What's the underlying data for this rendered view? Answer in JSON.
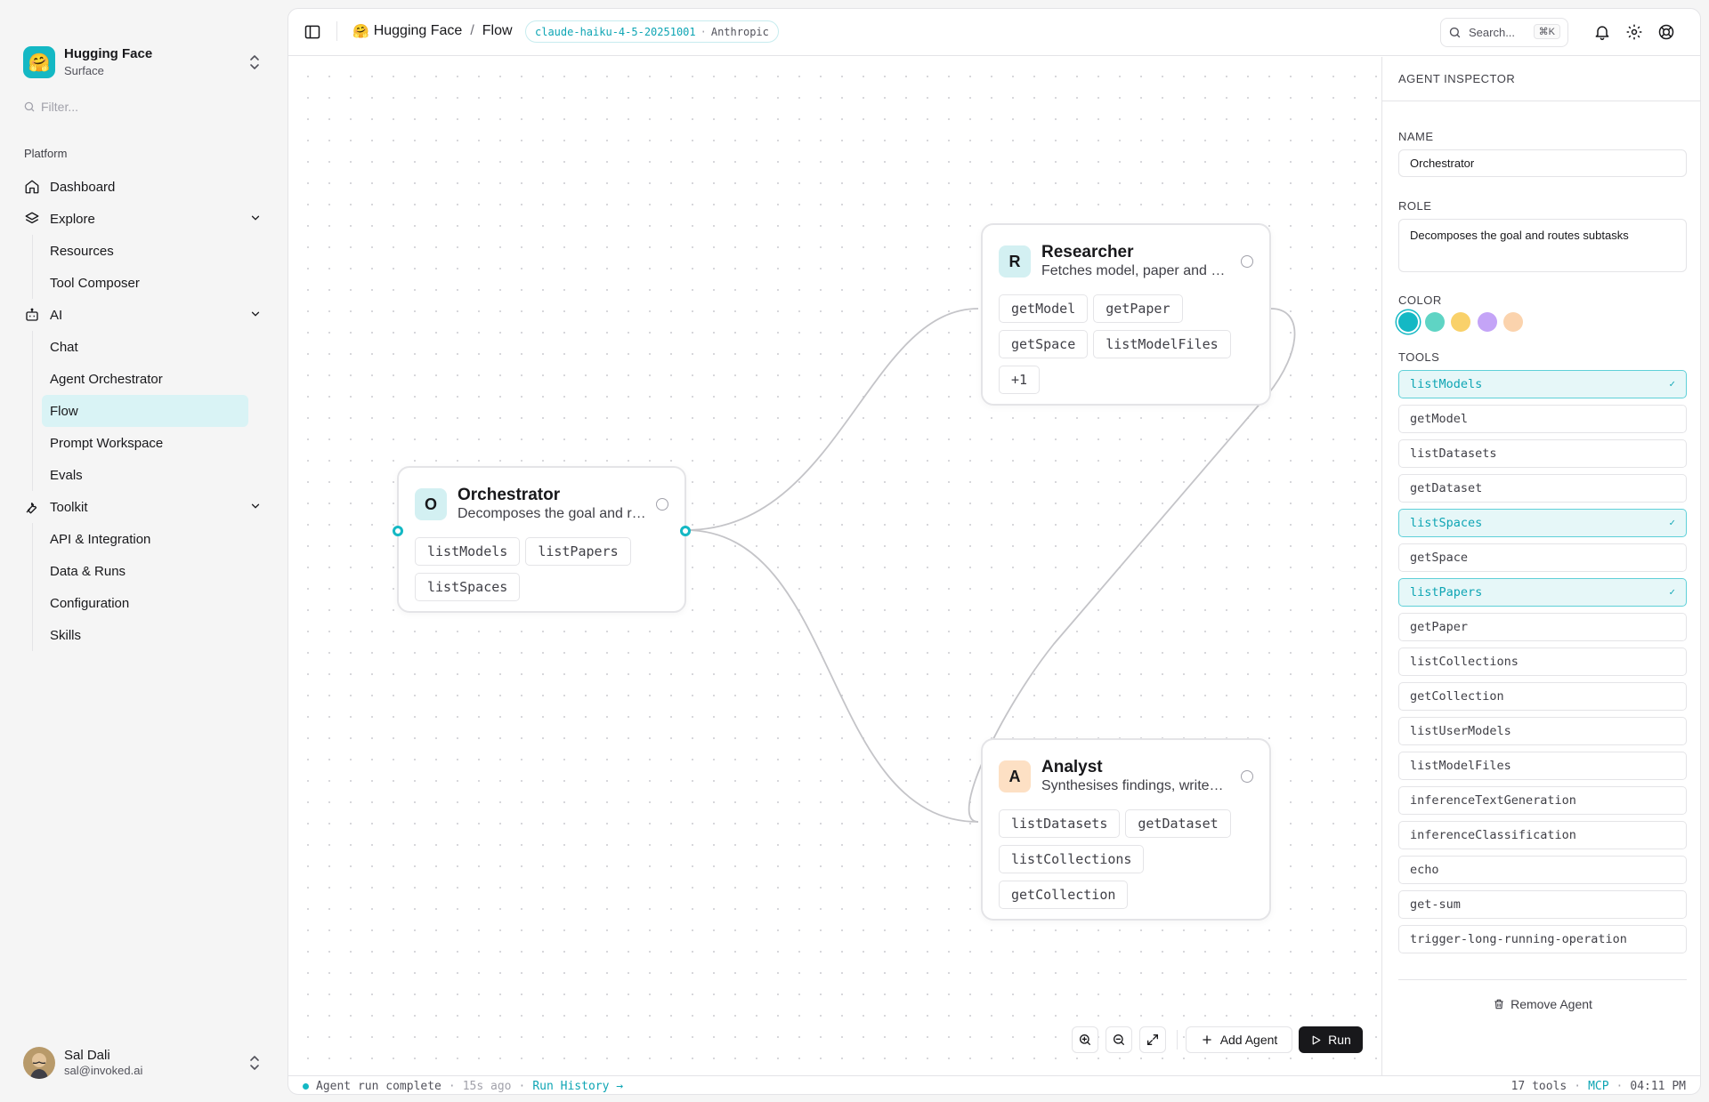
{
  "sidebar": {
    "brand": {
      "title": "Hugging Face",
      "subtitle": "Surface",
      "logo_emoji": "🤗"
    },
    "filter_placeholder": "Filter...",
    "section_label": "Platform",
    "nav": {
      "dashboard": "Dashboard",
      "explore": "Explore",
      "explore_items": [
        "Resources",
        "Tool Composer"
      ],
      "ai": "AI",
      "ai_items": [
        "Chat",
        "Agent Orchestrator",
        "Flow",
        "Prompt Workspace",
        "Evals"
      ],
      "ai_active": "Flow",
      "toolkit": "Toolkit",
      "toolkit_items": [
        "API & Integration",
        "Data & Runs",
        "Configuration",
        "Skills"
      ]
    },
    "user": {
      "name": "Sal Dali",
      "email": "sal@invoked.ai"
    }
  },
  "topbar": {
    "breadcrumb": {
      "org_emoji": "🤗",
      "org": "Hugging Face",
      "page": "Flow"
    },
    "model": {
      "id": "claude-haiku-4-5-20251001",
      "separator": "·",
      "provider": "Anthropic"
    },
    "search": {
      "placeholder": "Search...",
      "shortcut": "⌘K"
    }
  },
  "nodes": {
    "orchestrator": {
      "badge": "O",
      "badge_color": "#d3f0f2",
      "title": "Orchestrator",
      "desc": "Decomposes the goal and routes subtasks",
      "tools": [
        "listModels",
        "listPapers",
        "listSpaces"
      ]
    },
    "researcher": {
      "badge": "R",
      "badge_color": "#d3f0f2",
      "title": "Researcher",
      "desc": "Fetches model, paper and space details",
      "tools": [
        "getModel",
        "getPaper",
        "getSpace",
        "listModelFiles",
        "+1"
      ]
    },
    "analyst": {
      "badge": "A",
      "badge_color": "#fde0c4",
      "title": "Analyst",
      "desc": "Synthesises findings, writes the report",
      "tools": [
        "listDatasets",
        "getDataset",
        "listCollections",
        "getCollection"
      ]
    }
  },
  "canvas_controls": {
    "zoom_in": "zoom-in-icon",
    "zoom_out": "zoom-out-icon",
    "fit": "expand-icon",
    "add_agent": "Add Agent",
    "run": "Run"
  },
  "inspector": {
    "header": "AGENT INSPECTOR",
    "name_label": "NAME",
    "name_value": "Orchestrator",
    "role_label": "ROLE",
    "role_value": "Decomposes the goal and routes subtasks",
    "color_label": "COLOR",
    "colors": [
      "#14b8c4",
      "#5fd4c4",
      "#f9d16a",
      "#c4a4f7",
      "#fbd3ad"
    ],
    "selected_color": "#14b8c4",
    "tools_label": "TOOLS",
    "tools": [
      {
        "name": "listModels",
        "enabled": true
      },
      {
        "name": "getModel",
        "enabled": false
      },
      {
        "name": "listDatasets",
        "enabled": false
      },
      {
        "name": "getDataset",
        "enabled": false
      },
      {
        "name": "listSpaces",
        "enabled": true
      },
      {
        "name": "getSpace",
        "enabled": false
      },
      {
        "name": "listPapers",
        "enabled": true
      },
      {
        "name": "getPaper",
        "enabled": false
      },
      {
        "name": "listCollections",
        "enabled": false
      },
      {
        "name": "getCollection",
        "enabled": false
      },
      {
        "name": "listUserModels",
        "enabled": false
      },
      {
        "name": "listModelFiles",
        "enabled": false
      },
      {
        "name": "inferenceTextGeneration",
        "enabled": false
      },
      {
        "name": "inferenceClassification",
        "enabled": false
      },
      {
        "name": "echo",
        "enabled": false
      },
      {
        "name": "get-sum",
        "enabled": false
      },
      {
        "name": "trigger-long-running-operation",
        "enabled": false
      }
    ],
    "check_glyph": "✓",
    "remove_label": "Remove Agent"
  },
  "statusbar": {
    "status": "Agent run complete",
    "time_ago": "15s ago",
    "run_history": "Run History →",
    "tool_count": "17 tools",
    "mode": "MCP",
    "clock": "04:11 PM",
    "sep": "·"
  }
}
